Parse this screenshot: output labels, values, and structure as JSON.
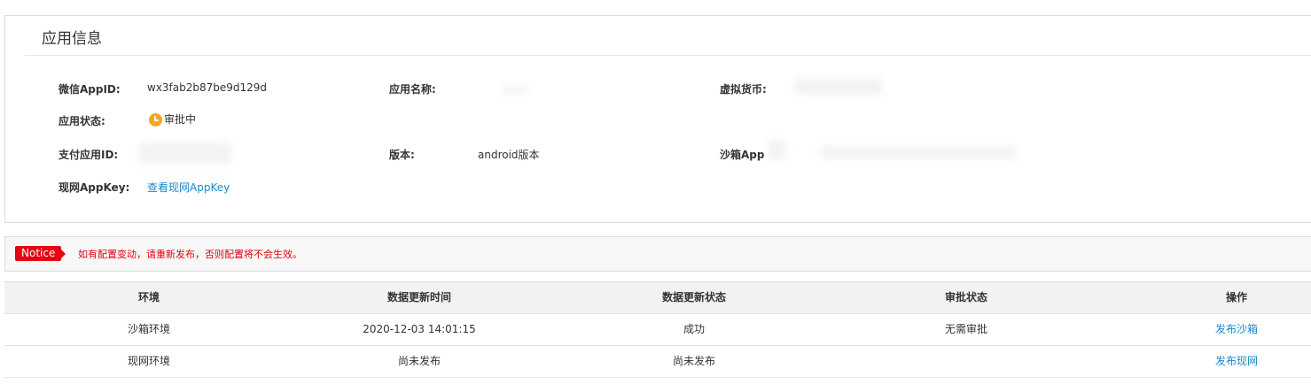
{
  "app_info": {
    "title": "应用信息",
    "appid_label": "微信AppID:",
    "appid_value": "wx3fab2b87be9d129d",
    "name_label": "应用名称:",
    "currency_label": "虚拟货币:",
    "status_label": "应用状态:",
    "status_value": "审批中",
    "pay_id_label": "支付应用ID:",
    "version_label": "版本:",
    "version_value": "android版本",
    "sandbox_label": "沙箱App",
    "appkey_label": "现网AppKey:",
    "appkey_link": "查看现网AppKey"
  },
  "notice": {
    "badge": "Notice",
    "text": "如有配置变动，请重新发布，否则配置将不会生效。"
  },
  "table": {
    "headers": [
      "环境",
      "数据更新时间",
      "数据更新状态",
      "审批状态",
      "操作"
    ],
    "rows": [
      [
        "沙箱环境",
        "2020-12-03 14:01:15",
        "成功",
        "无需审批",
        "发布沙箱"
      ],
      [
        "现网环境",
        "尚未发布",
        "尚未发布",
        "",
        "发布现网"
      ]
    ]
  },
  "colors": {
    "notice_red": "#e60012",
    "link_blue": "#1a8bc7",
    "status_orange": "#f5a623"
  },
  "icons": {
    "status": "clock-icon"
  }
}
